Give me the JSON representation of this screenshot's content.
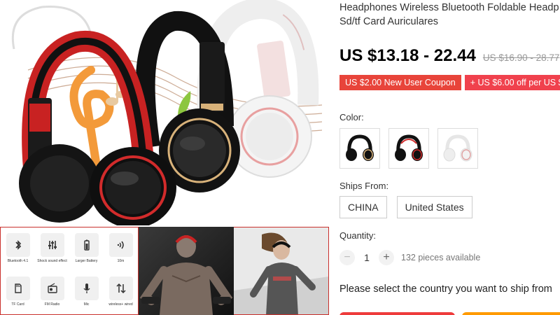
{
  "product": {
    "title_line1": "Headphones Wireless Bluetooth Foldable Headp",
    "title_line2": "Sd/tf Card Auriculares",
    "price": "US $13.18 - 22.44",
    "original_price": "US $16.90 - 28.77"
  },
  "coupons": [
    {
      "label": "US $2.00 New User Coupon"
    },
    {
      "label": "+ US $6.00 off per US $"
    }
  ],
  "color": {
    "label": "Color:",
    "options": [
      {
        "name": "black-gold",
        "band": "#111111",
        "accent": "#d8b27a"
      },
      {
        "name": "black-red",
        "band": "#111111",
        "accent": "#d22b2b"
      },
      {
        "name": "white-pink",
        "band": "#f2f2f2",
        "accent": "#e0a3a3"
      }
    ]
  },
  "ships_from": {
    "label": "Ships From:",
    "options": [
      "CHINA",
      "United States"
    ]
  },
  "quantity": {
    "label": "Quantity:",
    "value": "1",
    "minus": "−",
    "plus": "+",
    "available": "132 pieces available"
  },
  "ship_message": "Please select the country you want to ship from",
  "features": [
    {
      "icon": "bluetooth-icon",
      "label": "Bluetooth 4.1"
    },
    {
      "icon": "equalizer-icon",
      "label": "Shock sound effect"
    },
    {
      "icon": "battery-icon",
      "label": "Larger Battery"
    },
    {
      "icon": "signal-icon",
      "label": "10m"
    },
    {
      "icon": "sd-card-icon",
      "label": "TF Card"
    },
    {
      "icon": "radio-icon",
      "label": "FM Radio"
    },
    {
      "icon": "microphone-icon",
      "label": "Mic"
    },
    {
      "icon": "wired-wireless-icon",
      "label": "wireless+ wired"
    }
  ],
  "colors": {
    "price_red": "#e8443a",
    "coupon_pink": "#f0414d",
    "buy_red": "#ee3b3b",
    "cart_orange": "#ff9a00"
  }
}
